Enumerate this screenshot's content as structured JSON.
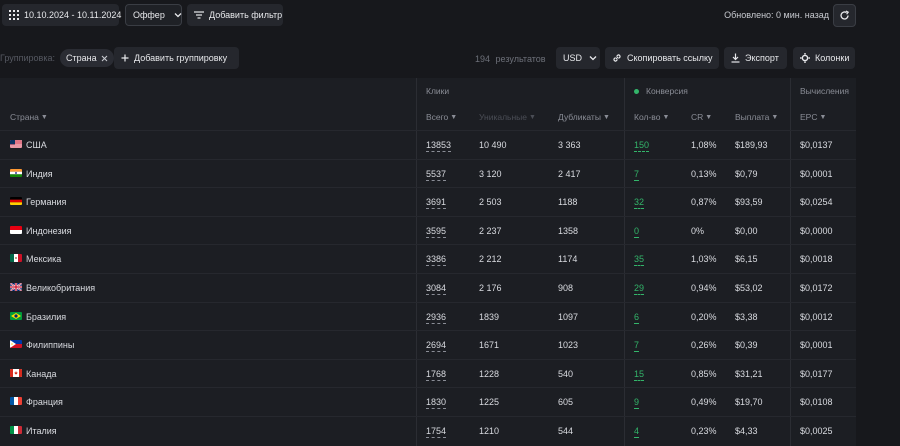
{
  "toolbar": {
    "date_range": "10.10.2024 - 10.11.2024",
    "offer_label": "Оффер",
    "add_filter_label": "Добавить фильтр",
    "updated_text": "Обновлено: 0 мин. назад"
  },
  "grouping": {
    "label": "Группировка:",
    "chip_label": "Страна",
    "add_grouping_label": "Добавить группировку",
    "results_count": "194",
    "results_word": "результатов",
    "currency": "USD",
    "copy_link_label": "Скопировать ссылку",
    "export_label": "Экспорт",
    "columns_label": "Колонки"
  },
  "table": {
    "groups": {
      "clicks": "Клики",
      "conversion": "Конверсия",
      "calculations": "Вычисления"
    },
    "headers": {
      "country": "Страна",
      "total": "Всего",
      "unique": "Уникальные",
      "duplicates": "Дубликаты",
      "count": "Кол-во",
      "cr": "CR",
      "payout": "Выплата",
      "epc": "EPC"
    },
    "rows": [
      {
        "flag": "us",
        "country": "США",
        "total": "13853",
        "unique": "10 490",
        "duplicates": "3 363",
        "count": "150",
        "cr": "1,08%",
        "payout": "$189,93",
        "epc": "$0,0137"
      },
      {
        "flag": "in",
        "country": "Индия",
        "total": "5537",
        "unique": "3 120",
        "duplicates": "2 417",
        "count": "7",
        "cr": "0,13%",
        "payout": "$0,79",
        "epc": "$0,0001"
      },
      {
        "flag": "de",
        "country": "Германия",
        "total": "3691",
        "unique": "2 503",
        "duplicates": "1188",
        "count": "32",
        "cr": "0,87%",
        "payout": "$93,59",
        "epc": "$0,0254"
      },
      {
        "flag": "id",
        "country": "Индонезия",
        "total": "3595",
        "unique": "2 237",
        "duplicates": "1358",
        "count": "0",
        "cr": "0%",
        "payout": "$0,00",
        "epc": "$0,0000"
      },
      {
        "flag": "mx",
        "country": "Мексика",
        "total": "3386",
        "unique": "2 212",
        "duplicates": "1174",
        "count": "35",
        "cr": "1,03%",
        "payout": "$6,15",
        "epc": "$0,0018"
      },
      {
        "flag": "gb",
        "country": "Великобритания",
        "total": "3084",
        "unique": "2 176",
        "duplicates": "908",
        "count": "29",
        "cr": "0,94%",
        "payout": "$53,02",
        "epc": "$0,0172"
      },
      {
        "flag": "br",
        "country": "Бразилия",
        "total": "2936",
        "unique": "1839",
        "duplicates": "1097",
        "count": "6",
        "cr": "0,20%",
        "payout": "$3,38",
        "epc": "$0,0012"
      },
      {
        "flag": "ph",
        "country": "Филиппины",
        "total": "2694",
        "unique": "1671",
        "duplicates": "1023",
        "count": "7",
        "cr": "0,26%",
        "payout": "$0,39",
        "epc": "$0,0001"
      },
      {
        "flag": "ca",
        "country": "Канада",
        "total": "1768",
        "unique": "1228",
        "duplicates": "540",
        "count": "15",
        "cr": "0,85%",
        "payout": "$31,21",
        "epc": "$0,0177"
      },
      {
        "flag": "fr",
        "country": "Франция",
        "total": "1830",
        "unique": "1225",
        "duplicates": "605",
        "count": "9",
        "cr": "0,49%",
        "payout": "$19,70",
        "epc": "$0,0108"
      },
      {
        "flag": "it",
        "country": "Италия",
        "total": "1754",
        "unique": "1210",
        "duplicates": "544",
        "count": "4",
        "cr": "0,23%",
        "payout": "$4,33",
        "epc": "$0,0025"
      }
    ]
  },
  "colors": {
    "background": "#17181c",
    "accent_green": "#33b56a"
  }
}
